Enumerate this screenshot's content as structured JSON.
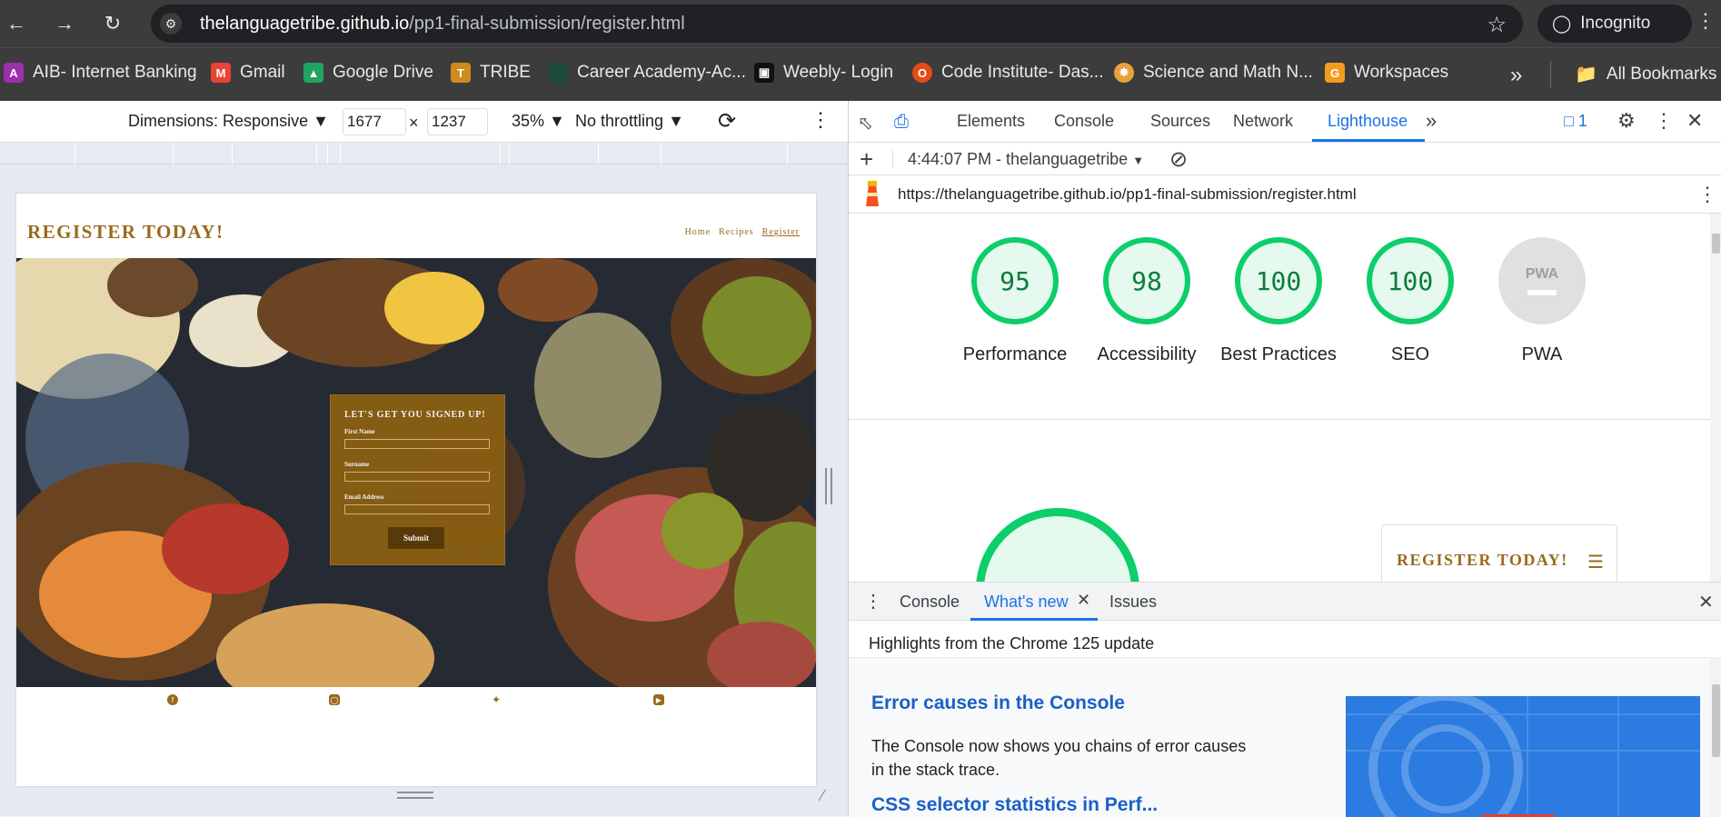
{
  "browser": {
    "url_host": "thelanguagetribe.github.io",
    "url_path": "/pp1-final-submission/register.html",
    "incognito_label": "Incognito"
  },
  "bookmarks": [
    {
      "label": "AIB- Internet Banking",
      "icon": "aib-icon",
      "color": "#9b2fae"
    },
    {
      "label": "Gmail",
      "icon": "gmail-icon",
      "color": "#ea4335"
    },
    {
      "label": "Google Drive",
      "icon": "drive-icon",
      "color": "#1fa463"
    },
    {
      "label": "TRIBE",
      "icon": "tribe-icon",
      "color": "#d08a1e"
    },
    {
      "label": "Career Academy-Ac...",
      "icon": "career-icon",
      "color": "#1e4b3c"
    },
    {
      "label": "Weebly- Login",
      "icon": "weebly-icon",
      "color": "#111111"
    },
    {
      "label": "Code Institute- Das...",
      "icon": "code-institute-icon",
      "color": "#e64a19"
    },
    {
      "label": "Science and Math N...",
      "icon": "science-icon",
      "color": "#e8a23a"
    },
    {
      "label": "Workspaces",
      "icon": "workspaces-icon",
      "color": "#f29b1d"
    }
  ],
  "all_bookmarks_label": "All Bookmarks",
  "device_toolbar": {
    "dimensions_label": "Dimensions: Responsive",
    "width_value": "1677",
    "times": "×",
    "height_value": "1237",
    "zoom": "35%",
    "throttling": "No throttling"
  },
  "emulated_page": {
    "title": "REGISTER TODAY!",
    "nav": [
      "Home",
      "Recipes",
      "Register"
    ],
    "form": {
      "heading": "LET'S GET YOU SIGNED UP!",
      "first_name_label": "First Name",
      "surname_label": "Surname",
      "email_label": "Email Address",
      "submit_label": "Submit"
    },
    "social_icons": [
      "facebook-icon",
      "instagram-icon",
      "twitter-icon",
      "youtube-icon"
    ]
  },
  "devtools": {
    "tabs": [
      "Elements",
      "Console",
      "Sources",
      "Network",
      "Lighthouse"
    ],
    "active_tab": "Lighthouse",
    "issues_count": "1",
    "report_label": "4:44:07 PM - thelanguagetribe",
    "report_url": "https://thelanguagetribe.github.io/pp1-final-submission/register.html",
    "scores": [
      {
        "value": "95",
        "label": "Performance"
      },
      {
        "value": "98",
        "label": "Accessibility"
      },
      {
        "value": "100",
        "label": "Best Practices"
      },
      {
        "value": "100",
        "label": "SEO"
      }
    ],
    "pwa_label": "PWA",
    "pwa_badge": "PWA",
    "thumbnail_title": "REGISTER TODAY!",
    "score_color": "#0cce6b",
    "drawer": {
      "tabs": [
        "Console",
        "What's new",
        "Issues"
      ],
      "active_tab": "What's new",
      "highlights": "Highlights from the Chrome 125 update",
      "article_title": "Error causes in the Console",
      "article_text": "The Console now shows you chains of error causes in the stack trace.",
      "next_title": "CSS selector statistics in Perf..."
    }
  }
}
